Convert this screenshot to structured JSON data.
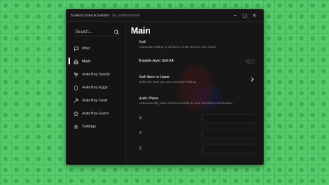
{
  "window": {
    "title": "EzHub Grow A Garden",
    "author": "by Justkondzio0",
    "controls": {
      "minimize": "–",
      "maximize": "▢",
      "close": "✕"
    }
  },
  "sidebar": {
    "search_placeholder": "Search...",
    "items": [
      {
        "label": "Misc",
        "icon": "chat-icon"
      },
      {
        "label": "Main",
        "icon": "home-icon",
        "active": true
      },
      {
        "label": "Auto Buy Seeds",
        "icon": "sprout-icon"
      },
      {
        "label": "Auto Buy Eggs",
        "icon": "egg-icon"
      },
      {
        "label": "Auto Buy Gear",
        "icon": "hammer-icon"
      },
      {
        "label": "Auto Buy Event",
        "icon": "star-icon"
      },
      {
        "label": "Settings",
        "icon": "gear-icon"
      }
    ]
  },
  "main": {
    "title": "Main",
    "sell": {
      "label": "Sell",
      "description": "Automate selling of all items or the item in your hand"
    },
    "enable_auto_sell_all": {
      "label": "Enable Auto Sell All",
      "enabled": false
    },
    "sell_item_in_hand": {
      "label": "Sell Item in Hand",
      "description": "Sells the item you are currently holding."
    },
    "auto_place": {
      "label": "Auto Place",
      "description": "Automatically plant selected seeds at your specified coordinates."
    },
    "coords": [
      {
        "label": "X",
        "value": ""
      },
      {
        "label": "Y",
        "value": ""
      },
      {
        "label": "Z",
        "value": ""
      }
    ]
  },
  "colors": {
    "background_green": "#56c96a",
    "window_bg": "#161616",
    "text_primary": "#ffffff",
    "text_muted": "#8e8e8e"
  }
}
